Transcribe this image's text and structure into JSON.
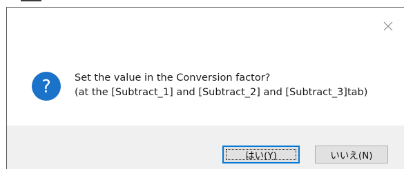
{
  "dialog": {
    "message_line1": "Set the value in the Conversion factor?",
    "message_line2": "(at the [Subtract_1] and [Subtract_2] and [Subtract_3]tab)",
    "icon": "question-icon",
    "icon_glyph": "?",
    "close_icon": "close-icon"
  },
  "buttons": {
    "yes_label": "はい(Y)",
    "no_label": "いいえ(N)"
  },
  "colors": {
    "icon_blue": "#1a72c9",
    "focus_border": "#0078d7",
    "footer_bg": "#f0f0f0",
    "button_bg": "#e1e1e1"
  }
}
